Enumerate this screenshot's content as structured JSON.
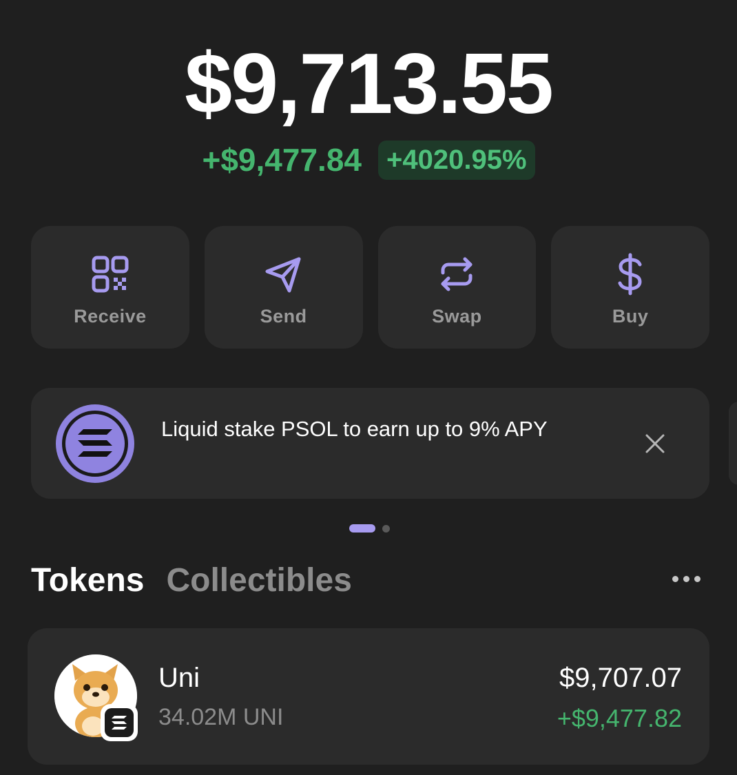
{
  "colors": {
    "background": "#1f1f1f",
    "card": "#2b2b2b",
    "accent": "#a79bf0",
    "positive": "#45b56e",
    "muted": "#8c8c8c"
  },
  "portfolio": {
    "balance": "$9,713.55",
    "change_amount": "+$9,477.84",
    "change_percent": "+4020.95%"
  },
  "actions": [
    {
      "label": "Receive",
      "icon": "qr-code-icon"
    },
    {
      "label": "Send",
      "icon": "send-icon"
    },
    {
      "label": "Swap",
      "icon": "swap-icon"
    },
    {
      "label": "Buy",
      "icon": "dollar-icon"
    }
  ],
  "banner": {
    "text": "Liquid stake PSOL to earn up to 9% APY",
    "icon": "solana-logo-icon",
    "close_icon": "close-icon",
    "page_count": 2,
    "active_page": 1
  },
  "tabs": [
    {
      "label": "Tokens",
      "active": true
    },
    {
      "label": "Collectibles",
      "active": false
    }
  ],
  "more_icon": "more-options-icon",
  "tokens": [
    {
      "name": "Uni",
      "quantity": "34.02M UNI",
      "value": "$9,707.07",
      "change": "+$9,477.82",
      "icon": "shiba-token-avatar",
      "chain_icon": "solana-badge-icon"
    }
  ]
}
